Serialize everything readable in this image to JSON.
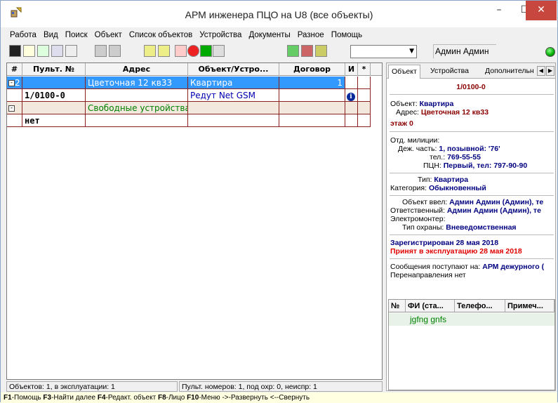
{
  "window": {
    "title": "АРМ инженера ПЦО на U8 (все объекты)",
    "min_glyph": "–",
    "max_glyph": "☐",
    "close_glyph": "✕"
  },
  "menu": [
    "Работа",
    "Вид",
    "Поиск",
    "Объект",
    "Список объектов",
    "Устройства",
    "Документы",
    "Разное",
    "Помощь"
  ],
  "toolbar": {
    "combo_value": "",
    "user": "Админ Админ"
  },
  "grid": {
    "headers": [
      "#",
      "Пульт. №",
      "Адрес",
      "Объект/Устро...",
      "Договор",
      "И",
      "*"
    ],
    "rows": [
      {
        "num": "2",
        "pult": "",
        "address": "Цветочная 12 кв33",
        "object": "Квартира",
        "contract": "1",
        "i": "",
        "star": ""
      },
      {
        "num": "",
        "pult": "1/0100-0",
        "address": "",
        "object": "Редут Net GSM",
        "contract": "",
        "i": "i",
        "star": ""
      },
      {
        "num": "",
        "pult": "",
        "address": "Свободные устройства",
        "object": "",
        "contract": "",
        "i": "",
        "star": ""
      },
      {
        "num": "",
        "pult": "нет",
        "address": "",
        "object": "",
        "contract": "",
        "i": "",
        "star": ""
      }
    ]
  },
  "status": {
    "left": "Объектов: 1, в эксплуатации: 1",
    "right": "Пульт. номеров: 1, под охр: 0, неиспр: 1"
  },
  "hint": {
    "f1_key": "F1",
    "f1": "-Помощь ",
    "f3_key": "F3",
    "f3": "-Найти далее ",
    "f4_key": "F4",
    "f4": "-Редакт. объект ",
    "f8_key": "F8",
    "f8": "-Лицо ",
    "f10_key": "F10",
    "f10": "-Меню ",
    "rest": "->-Развернуть <--Свернуть"
  },
  "side": {
    "tabs": [
      "Объект",
      "Устройства",
      "Дополнительн"
    ],
    "pult_number": "1/0100-0",
    "object_label": "Объект:",
    "object_value": "Квартира",
    "address_label": "Адрес:",
    "address_value": "Цветочная 12 кв33",
    "floor": "этаж 0",
    "police_label": "Отд. милиции:",
    "duty_label": "Деж. часть:",
    "duty_value": "1, позывной: '76'",
    "tel_label": "тел.:",
    "tel_value": "769-55-55",
    "pcn_label": "ПЦН:",
    "pcn_value": "Первый, тел: 797-90-90",
    "type_label": "Тип:",
    "type_value": "Квартира",
    "category_label": "Категория:",
    "category_value": "Обыкновенный",
    "entered_label": "Объект ввел:",
    "entered_value": "Админ Админ (Админ), те",
    "responsible_label": "Ответственный:",
    "responsible_value": "Админ Админ (Админ), те",
    "electro_label": "Электромонтер:",
    "guard_label": "Тип охраны:",
    "guard_value": "Вневедомственная",
    "registered": "Зарегистрирован 28 мая 2018",
    "accepted": "Принят в эксплуатацию 28 мая 2018",
    "messages_label": "Сообщения поступают на:",
    "messages_value": "АРМ дежурного (",
    "redirect": "Перенаправления нет",
    "sub_headers": [
      "№",
      "ФИ (ста...",
      "Телефо...",
      "Примеч..."
    ],
    "sub_row": "jgfng gnfs"
  }
}
